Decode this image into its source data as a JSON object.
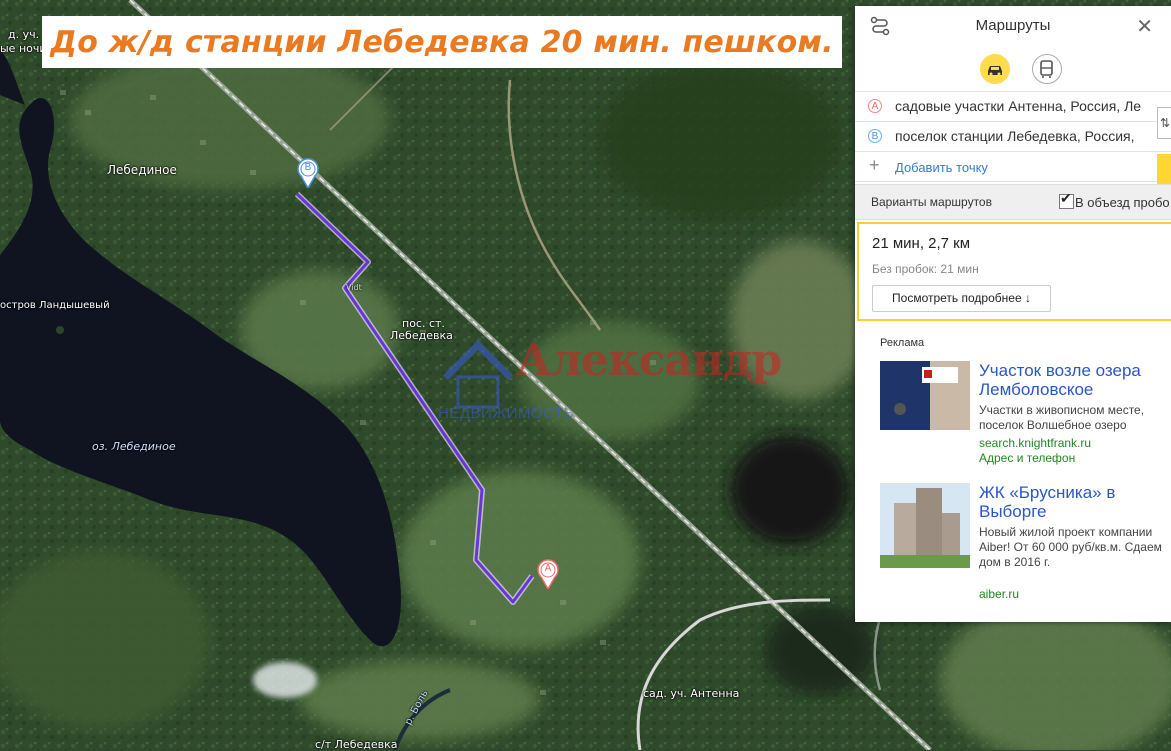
{
  "banner": {
    "text": "До ж/д станции Лебедевка 20 мин. пешком."
  },
  "map_labels": {
    "top_left_1": "д. уч.",
    "top_left_2": "ые ночи",
    "lebedinoe": "Лебединое",
    "island": "остров Ландышевый",
    "lake": "оз. Лебединое",
    "station_1": "пос. ст.",
    "station_2": "Лебедевка",
    "vidt": "Vidt",
    "antenna": "сад. уч. Антенна",
    "river": "р. Боль",
    "st_lebedevka": "с/т Лебедевка"
  },
  "markers": {
    "a": "A",
    "b": "B"
  },
  "watermark": {
    "name": "Александр",
    "sub": "НЕДВИЖИМОСТЬ"
  },
  "panel": {
    "title": "Маршруты",
    "close": "✕",
    "point_a": "садовые участки Антенна, Россия, Ле",
    "point_b": "поселок станции Лебедевка, Россия,",
    "add_point": "Добавить точку",
    "variants_label": "Варианты маршрутов",
    "avoid_jams": "В объезд пробо",
    "route_time": "21 мин, 2,7 км",
    "no_jams": "Без пробок: 21 мин",
    "details_button": "Посмотреть подробнее ↓",
    "ads_title": "Реклама",
    "ads": [
      {
        "title": "Участок возле озера Лемболовское",
        "desc": "Участки в живописном месте, поселок Волшебное озеро",
        "url": "search.knightfrank.ru",
        "extra": "Адрес и телефон"
      },
      {
        "title": "ЖК «Брусника» в Выборге",
        "desc": "Новый жилой проект компании Aiber! От 60 000 руб/кв.м. Сдаем дом в 2016 г.",
        "url": "aiber.ru"
      }
    ]
  },
  "colors": {
    "route": "#6a35d6",
    "banner_text": "#ea7a22",
    "car_mode": "#ffdb4d",
    "link": "#2b56c8",
    "ad_url": "#1d8a1d"
  }
}
